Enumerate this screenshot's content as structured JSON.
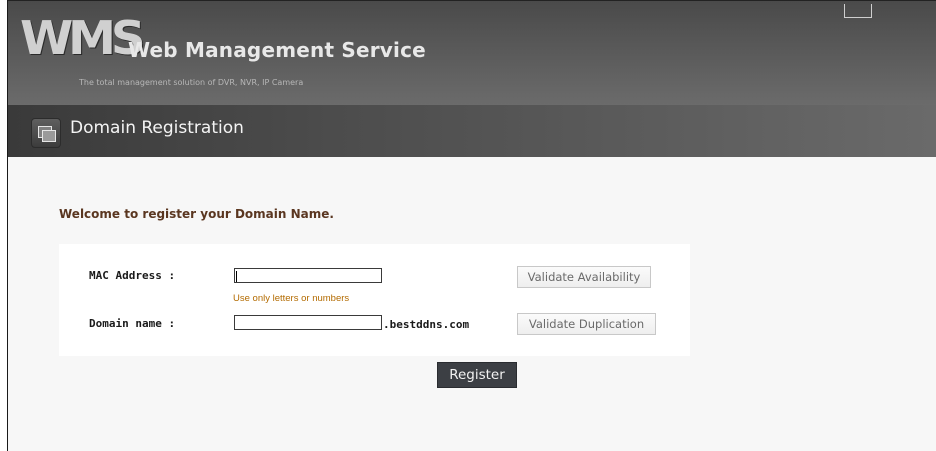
{
  "header": {
    "logo_text": "WMS",
    "brand": "Web Management Service",
    "tagline": "The total management solution of DVR, NVR, IP Camera"
  },
  "page": {
    "title": "Domain Registration",
    "icon": "windows-stack-icon"
  },
  "form": {
    "welcome": "Welcome to register your Domain Name.",
    "mac_label": "MAC Address :",
    "mac_value": "",
    "mac_hint": "Use only letters or numbers",
    "validate_availability_label": "Validate Availability",
    "domain_label": "Domain name :",
    "domain_value": "",
    "domain_suffix": ".bestddns.com",
    "validate_duplication_label": "Validate Duplication",
    "register_label": "Register"
  },
  "colors": {
    "welcome_text": "#5a3620",
    "hint_text": "#b36b00",
    "register_button": "#3c3f44"
  }
}
